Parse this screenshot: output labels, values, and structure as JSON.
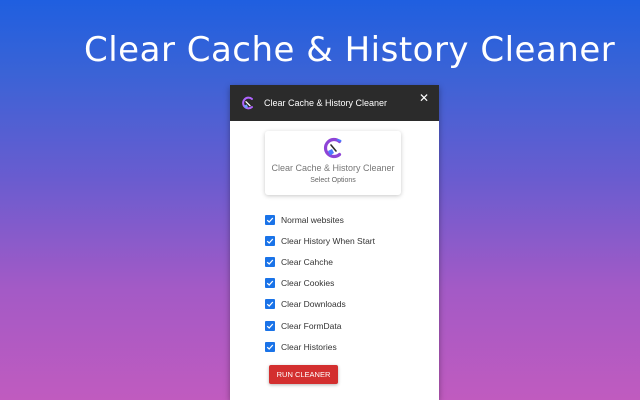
{
  "hero": {
    "title": "Clear Cache & History Cleaner"
  },
  "popup": {
    "header_title": "Clear Cache & History Cleaner",
    "close_icon": "✕",
    "card": {
      "title": "Clear Cache & History Cleaner",
      "subtitle": "Select Options"
    },
    "options": [
      {
        "label": "Normal websites",
        "checked": true
      },
      {
        "label": "Clear History When Start",
        "checked": true
      },
      {
        "label": "Clear Cahche",
        "checked": true
      },
      {
        "label": "Clear Cookies",
        "checked": true
      },
      {
        "label": "Clear Downloads",
        "checked": true
      },
      {
        "label": "Clear FormData",
        "checked": true
      },
      {
        "label": "Clear Histories",
        "checked": true
      }
    ],
    "run_button": "RUN CLEANER"
  },
  "colors": {
    "accent": "#1a73e8",
    "button": "#d32f2f",
    "header": "#2b2b2b",
    "logo_purple": "#8e44d6"
  },
  "icons": {
    "logo": "broom-c-logo-icon",
    "checkbox": "check-icon",
    "close": "close-icon"
  }
}
